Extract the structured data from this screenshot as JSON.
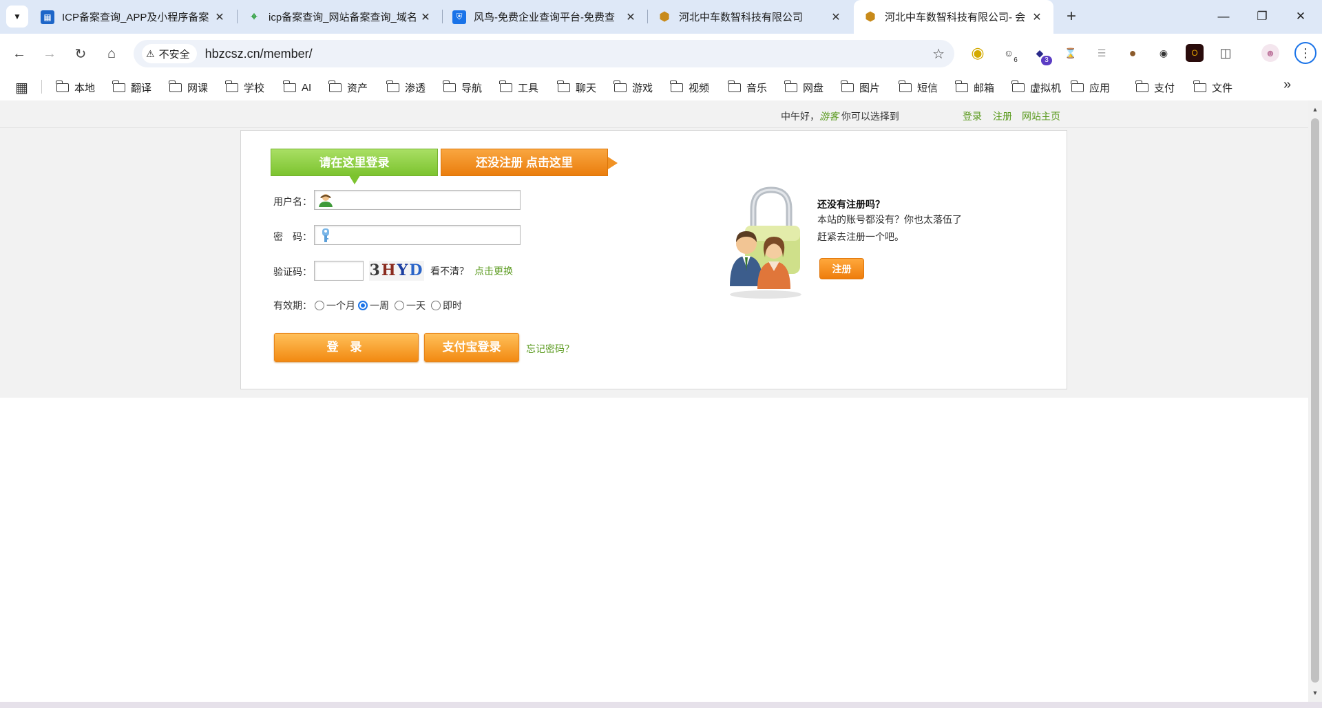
{
  "browser": {
    "tabs": [
      {
        "title": "ICP备案查询_APP及小程序备案",
        "favicon": "icp-favicon",
        "active": false
      },
      {
        "title": "icp备案查询_网站备案查询_域名",
        "favicon": "chinaz-favicon",
        "active": false
      },
      {
        "title": "风鸟-免费企业查询平台-免费查",
        "favicon": "fengniao-favicon",
        "active": false
      },
      {
        "title": "河北中车数智科技有限公司",
        "favicon": "company-favicon",
        "active": false
      },
      {
        "title": "河北中车数智科技有限公司- 会",
        "favicon": "company-favicon",
        "active": true
      }
    ],
    "security_label": "不安全",
    "url": "hbzcsz.cn/member/",
    "extension_badges": {
      "ext2": "6",
      "ext3": "3"
    },
    "bookmarks": [
      "本地",
      "翻译",
      "网课",
      "学校",
      "AI",
      "资产",
      "渗透",
      "导航",
      "工具",
      "聊天",
      "游戏",
      "视频",
      "音乐",
      "网盘",
      "图片",
      "短信",
      "邮箱",
      "虚拟机",
      "应用",
      "支付",
      "文件"
    ]
  },
  "topbar": {
    "greeting_prefix": "中午好，",
    "guest": "游客",
    "greeting_suffix": " 你可以选择到",
    "login": "登录",
    "register": "注册",
    "home": "网站主页"
  },
  "form": {
    "tab_login": "请在这里登录",
    "tab_register": "还没注册 点击这里",
    "username_label": "用户名：",
    "password_label": "密　码：",
    "captcha_label": "验证码：",
    "captcha_chars": [
      "3",
      "H",
      "Y",
      "D"
    ],
    "cant_see": "看不清？",
    "refresh": "点击更换",
    "validity_label": "有效期：",
    "validity_options": [
      "一个月",
      "一周",
      "一天",
      "即时"
    ],
    "validity_selected": "一周",
    "login_button": "登 录",
    "alipay_button": "支付宝登录",
    "forgot": "忘记密码？"
  },
  "sidebar": {
    "title": "还没有注册吗？",
    "line1": "本站的账号都没有？你也太落伍了",
    "line2": "赶紧去注册一个吧。",
    "register_button": "注册"
  },
  "colors": {
    "accent_green": "#7cc32f",
    "accent_orange": "#f28a12",
    "link_green": "#5a9a1e"
  }
}
